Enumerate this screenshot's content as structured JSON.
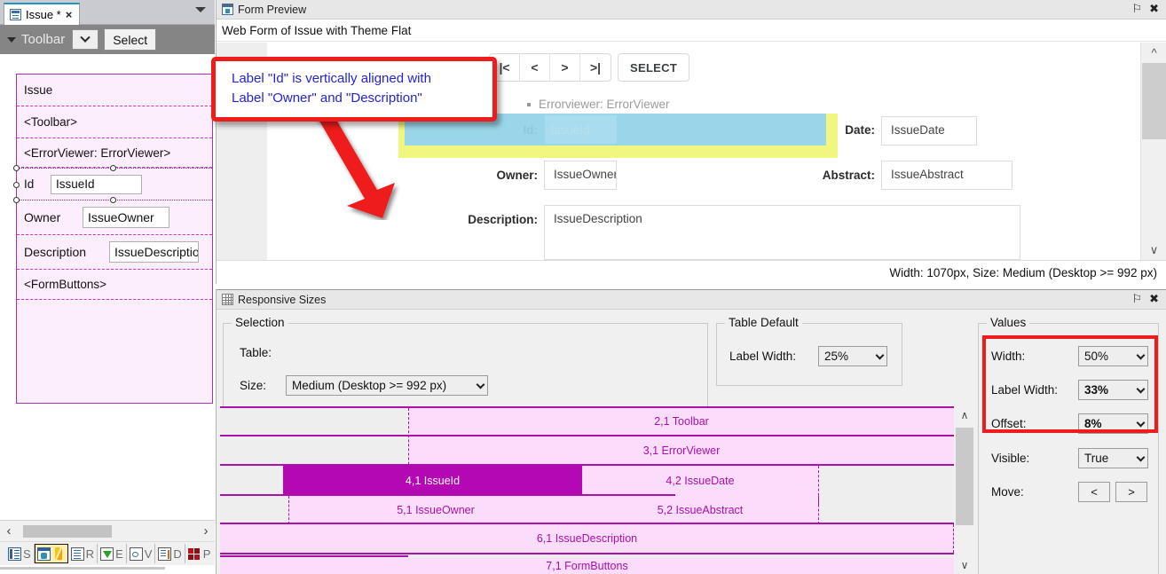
{
  "left_panel": {
    "tab": {
      "title": "Issue *",
      "icon": "form-document-icon",
      "close": "×"
    },
    "toolbar": {
      "label": "Toolbar",
      "combo_icon": "chevron-down-icon",
      "select_label": "Select"
    },
    "designer_rows": [
      {
        "name": "form-title-row",
        "label": "Issue",
        "input": null
      },
      {
        "name": "toolbar-placeholder-row",
        "label": "<Toolbar>",
        "input": null
      },
      {
        "name": "errorviewer-placeholder-row",
        "label": "<ErrorViewer: ErrorViewer>",
        "input": null
      },
      {
        "name": "id-row",
        "label": "Id",
        "input": "IssueId"
      },
      {
        "name": "owner-row",
        "label": "Owner",
        "input": "IssueOwner"
      },
      {
        "name": "description-row",
        "label": "Description",
        "input": "IssueDescriptio"
      },
      {
        "name": "formbuttons-placeholder-row",
        "label": "<FormButtons>",
        "input": null
      }
    ],
    "hscroll": {
      "left_arrow": "‹",
      "right_arrow": "›"
    },
    "icon_bar": [
      {
        "name": "structure-icon",
        "letter": "S",
        "active": false
      },
      {
        "name": "form-preview-icon",
        "letter": "",
        "active": true
      },
      {
        "name": "report-icon",
        "letter": "R",
        "active": false
      },
      {
        "name": "expression-icon",
        "letter": "E",
        "active": false
      },
      {
        "name": "view-icon",
        "letter": "V",
        "active": false
      },
      {
        "name": "data-icon",
        "letter": "D",
        "active": false
      },
      {
        "name": "properties-icon",
        "letter": "P",
        "active": false
      }
    ]
  },
  "callout": {
    "text": "Label \"Id\" is vertically aligned with\nLabel \"Owner\" and \"Description\"",
    "border_color": "#ee1c1c",
    "text_color": "#2323d8"
  },
  "form_preview": {
    "caption": "Form Preview",
    "pin_icon": "⚐",
    "close_icon": "✖",
    "subcaption": "Web Form of Issue with Theme Flat",
    "nav_buttons": [
      "|<",
      "<",
      ">",
      ">|"
    ],
    "select_button": "SELECT",
    "errorviewer_line": "Errorviewer: ErrorViewer",
    "fields": [
      {
        "name": "id-field",
        "label": "Id:",
        "value": "IssueId",
        "highlight": "blue"
      },
      {
        "name": "date-field",
        "label": "Date:",
        "value": "IssueDate",
        "highlight": "none"
      },
      {
        "name": "owner-field",
        "label": "Owner:",
        "value": "IssueOwner",
        "highlight": "none"
      },
      {
        "name": "abstract-field",
        "label": "Abstract:",
        "value": "IssueAbstract",
        "highlight": "none"
      },
      {
        "name": "description-field",
        "label": "Description:",
        "value": "IssueDescription",
        "highlight": "none"
      }
    ],
    "status": "Width: 1070px, Size: Medium (Desktop >= 992 px)",
    "highlight_colors": {
      "row": "#f1f77e",
      "cell": "#9ad6ea"
    }
  },
  "responsive_sizes": {
    "caption": "Responsive Sizes",
    "pin_icon": "⚐",
    "close_icon": "✖",
    "selection": {
      "title": "Selection",
      "table_label": "Table:",
      "table_value": "",
      "size_label": "Size:",
      "size_value": "Medium (Desktop >= 992 px)"
    },
    "table_default": {
      "title": "Table Default",
      "label_width_label": "Label Width:",
      "label_width_value": "25%"
    },
    "values": {
      "title": "Values",
      "width_label": "Width:",
      "width_value": "50%",
      "label_width_label": "Label Width:",
      "label_width_value": "33%",
      "offset_label": "Offset:",
      "offset_value": "8%",
      "visible_label": "Visible:",
      "visible_value": "True",
      "move_label": "Move:",
      "move_prev": "<",
      "move_next": ">"
    },
    "grid_rows": [
      {
        "name": "row-toolbar",
        "cells": [
          {
            "text": "2,1 Toolbar",
            "state": "filled"
          }
        ]
      },
      {
        "name": "row-errorviewer",
        "cells": [
          {
            "text": "3,1 ErrorViewer",
            "state": "filled"
          }
        ]
      },
      {
        "name": "row-issueid",
        "cells": [
          {
            "text": "4,1 IssueId",
            "state": "selected"
          },
          {
            "text": "4,2 IssueDate",
            "state": "filled"
          }
        ]
      },
      {
        "name": "row-issueowner",
        "cells": [
          {
            "text": "5,1 IssueOwner",
            "state": "filled"
          },
          {
            "text": "5,2 IssueAbstract",
            "state": "filled"
          }
        ]
      },
      {
        "name": "row-issuedescription",
        "cells": [
          {
            "text": "6,1 IssueDescription",
            "state": "filled"
          }
        ]
      },
      {
        "name": "row-formbuttons",
        "cells": [
          {
            "text": "7,1 FormButtons",
            "state": "filled"
          }
        ]
      }
    ],
    "grid_colors": {
      "line": "#aa11aa",
      "filled": "#fbdcfb",
      "selected": "#b408b4",
      "empty": "#eeeeee"
    },
    "scroll": {
      "up": "∧",
      "down": "∨"
    }
  }
}
